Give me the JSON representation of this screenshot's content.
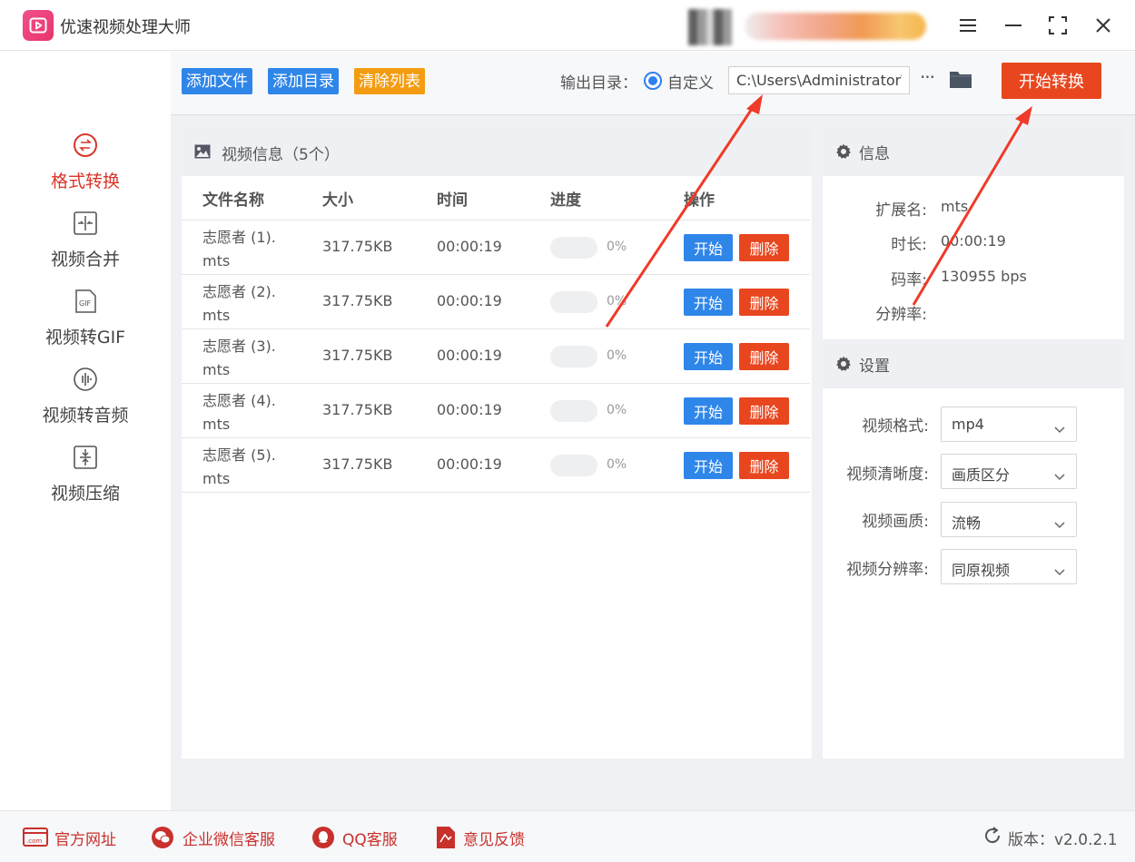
{
  "app": {
    "title": "优速视频处理大师"
  },
  "window": {
    "controls": [
      "menu-icon",
      "minimize-icon",
      "maximize-icon",
      "close-icon"
    ]
  },
  "sidebar": {
    "items": [
      {
        "label": "格式转换",
        "icon": "format-convert-icon",
        "active": true
      },
      {
        "label": "视频合并",
        "icon": "merge-icon",
        "active": false
      },
      {
        "label": "视频转GIF",
        "icon": "gif-icon",
        "active": false
      },
      {
        "label": "视频转音频",
        "icon": "audio-icon",
        "active": false
      },
      {
        "label": "视频压缩",
        "icon": "compress-icon",
        "active": false
      }
    ]
  },
  "toolbar": {
    "add_file": "添加文件",
    "add_dir": "添加目录",
    "clear_list": "清除列表",
    "output_label": "输出目录：",
    "radio_label": "自定义",
    "output_path": "C:\\Users\\Administrator\\",
    "more": "···",
    "start_all": "开始转换"
  },
  "video_list": {
    "title": "视频信息（5个）",
    "columns": [
      "文件名称",
      "大小",
      "时间",
      "进度",
      "操作"
    ],
    "rows": [
      {
        "name_line1": "志愿者 (1).",
        "name_line2": "mts",
        "size": "317.75KB",
        "time": "00:00:19",
        "progress": "0%",
        "start": "开始",
        "delete": "删除"
      },
      {
        "name_line1": "志愿者 (2).",
        "name_line2": "mts",
        "size": "317.75KB",
        "time": "00:00:19",
        "progress": "0%",
        "start": "开始",
        "delete": "删除"
      },
      {
        "name_line1": "志愿者 (3).",
        "name_line2": "mts",
        "size": "317.75KB",
        "time": "00:00:19",
        "progress": "0%",
        "start": "开始",
        "delete": "删除"
      },
      {
        "name_line1": "志愿者 (4).",
        "name_line2": "mts",
        "size": "317.75KB",
        "time": "00:00:19",
        "progress": "0%",
        "start": "开始",
        "delete": "删除"
      },
      {
        "name_line1": "志愿者 (5).",
        "name_line2": "mts",
        "size": "317.75KB",
        "time": "00:00:19",
        "progress": "0%",
        "start": "开始",
        "delete": "删除"
      }
    ]
  },
  "info": {
    "title": "信息",
    "ext_label": "扩展名:",
    "ext_value": "mts",
    "duration_label": "时长:",
    "duration_value": "00:00:19",
    "bitrate_label": "码率:",
    "bitrate_value": "130955 bps",
    "resolution_label": "分辨率:",
    "resolution_value": ""
  },
  "settings": {
    "title": "设置",
    "format_label": "视频格式:",
    "format_value": "mp4",
    "clarity_label": "视频清晰度:",
    "clarity_value": "画质区分",
    "quality_label": "视频画质:",
    "quality_value": "流畅",
    "resolution_label": "视频分辨率:",
    "resolution_value": "同原视频"
  },
  "footer": {
    "website": "官方网址",
    "wechat": "企业微信客服",
    "qq": "QQ客服",
    "feedback": "意见反馈",
    "version": "版本：v2.0.2.1"
  },
  "colors": {
    "accent_red": "#e8461e",
    "accent_blue": "#2f86e9",
    "accent_orange": "#f39c12",
    "active_text": "#d9352b"
  }
}
